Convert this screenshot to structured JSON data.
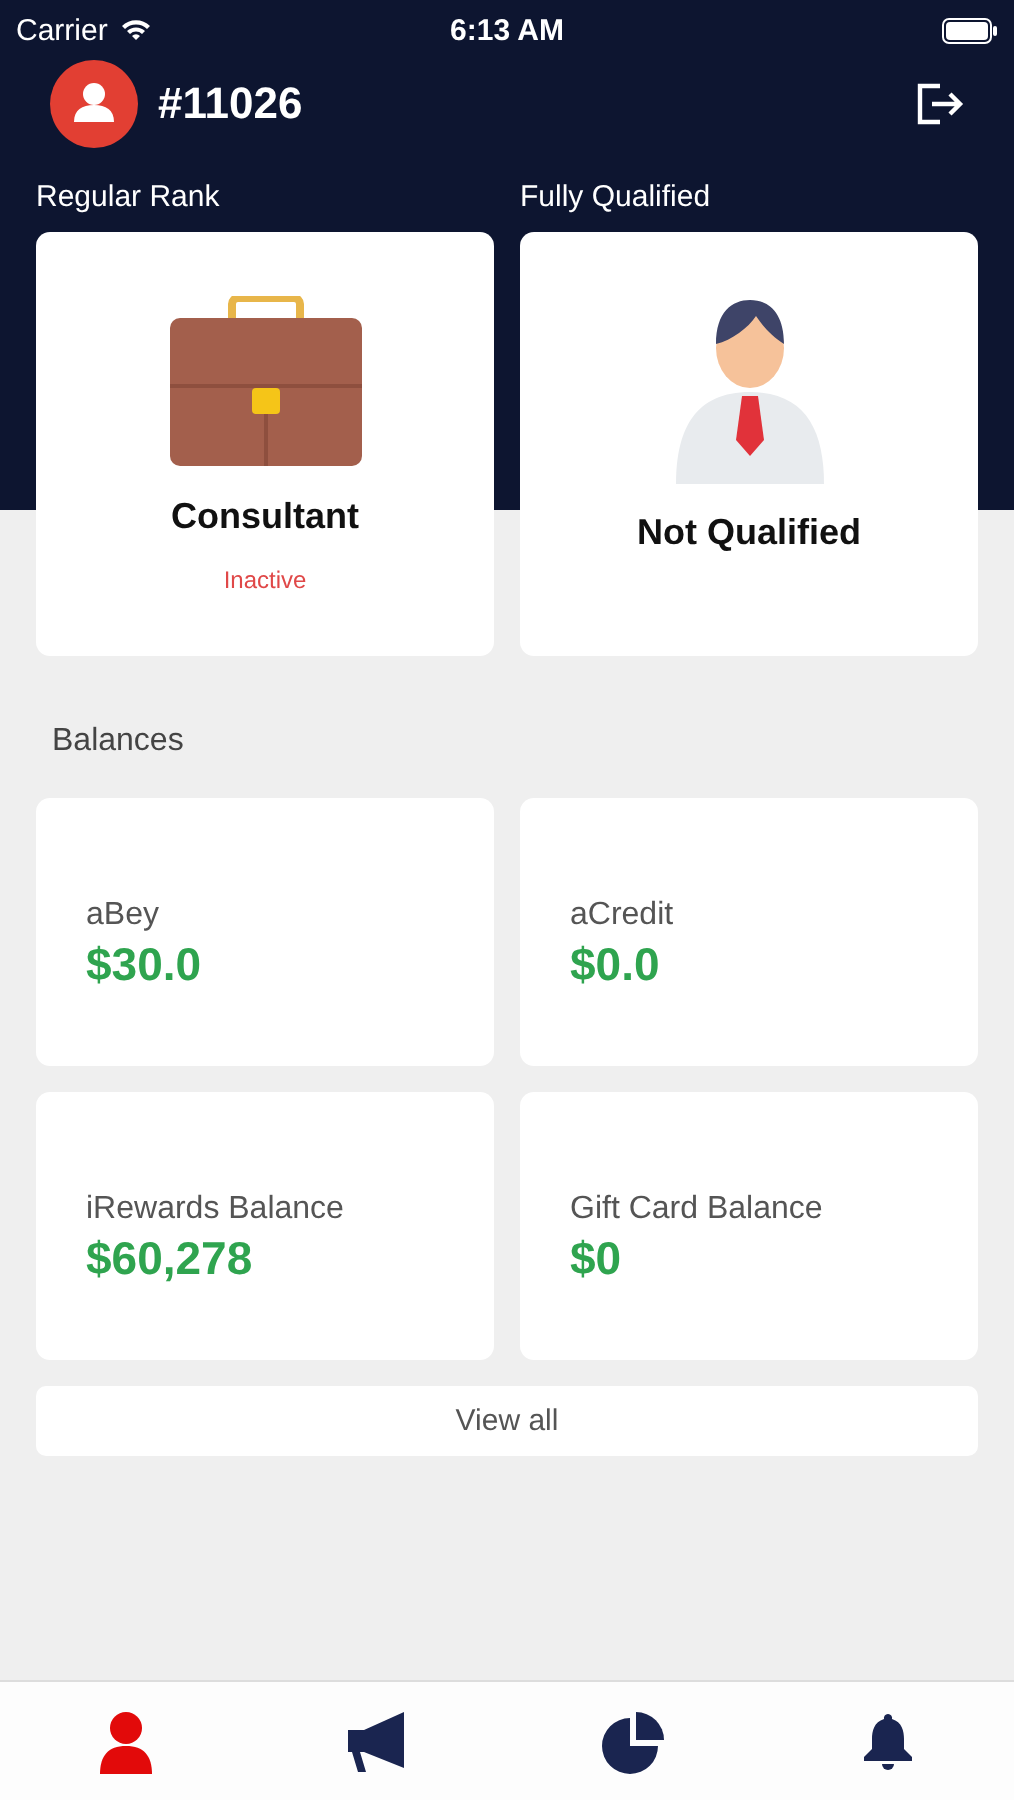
{
  "status_bar": {
    "carrier": "Carrier",
    "time": "6:13 AM"
  },
  "header": {
    "member_id": "#11026"
  },
  "ranks": [
    {
      "label": "Regular Rank",
      "kind": "briefcase",
      "title": "Consultant",
      "status": "Inactive"
    },
    {
      "label": "Fully Qualified",
      "kind": "person",
      "title": "Not Qualified"
    }
  ],
  "balances_heading": "Balances",
  "balances": [
    {
      "label": "aBey",
      "amount": "$30.0"
    },
    {
      "label": "aCredit",
      "amount": "$0.0"
    },
    {
      "label": "iRewards Balance",
      "amount": "$60,278"
    },
    {
      "label": "Gift Card Balance",
      "amount": "$0"
    }
  ],
  "view_all": "View all",
  "tabs": [
    {
      "kind": "profile",
      "selected": true
    },
    {
      "kind": "megaphone",
      "selected": false
    },
    {
      "kind": "chart",
      "selected": false
    },
    {
      "kind": "bell",
      "selected": false
    }
  ]
}
